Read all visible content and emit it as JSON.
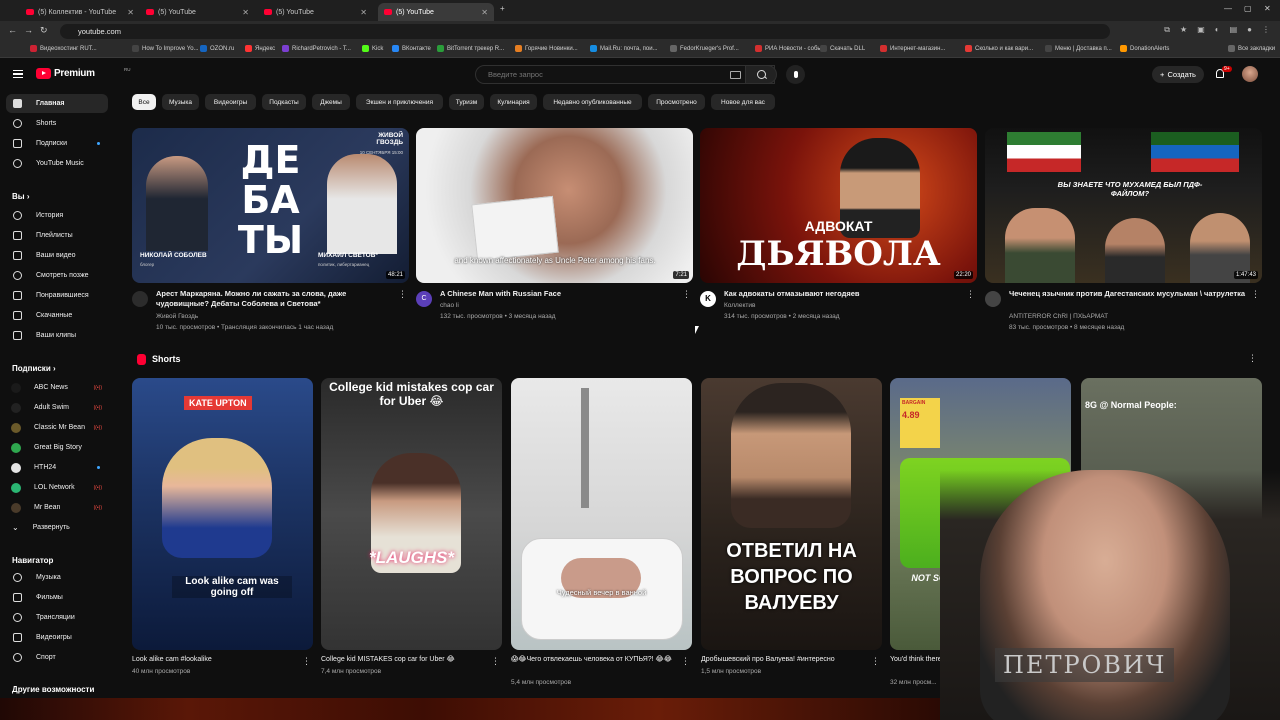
{
  "browser": {
    "tabs": [
      {
        "label": "(5) Коллектив - YouTube"
      },
      {
        "label": "(5) YouTube"
      },
      {
        "label": "(5) YouTube"
      },
      {
        "label": "(5) YouTube"
      }
    ],
    "url": "youtube.com",
    "bookmarks": [
      "Видеохостинг RUT...",
      "How To Improve Yo...",
      "OZON.ru",
      "Яндекс",
      "RichardPetrovich - T...",
      "Kick",
      "ВКонтакте",
      "BitTorrent трекер R...",
      "Горячие Новинки...",
      "Mail.Ru: почта, пои...",
      "FedorKrueger's Prof...",
      "РИА Новости - собы...",
      "Скачать DLL",
      "Интернет-магазин...",
      "Сколько и как вари...",
      "Меню | Доставка п...",
      "DonationAlerts",
      "Все закладки"
    ]
  },
  "header": {
    "logo": "Premium",
    "logo_region": "RU",
    "search_placeholder": "Введите запрос",
    "create_label": "Создать",
    "notif_count": "9+"
  },
  "sidebar": {
    "main": [
      {
        "label": "Главная"
      },
      {
        "label": "Shorts"
      },
      {
        "label": "Подписки"
      },
      {
        "label": "YouTube Music"
      }
    ],
    "you_header": "Вы",
    "you": [
      {
        "label": "История"
      },
      {
        "label": "Плейлисты"
      },
      {
        "label": "Ваши видео"
      },
      {
        "label": "Смотреть позже"
      },
      {
        "label": "Понравившиеся"
      },
      {
        "label": "Скачанные"
      },
      {
        "label": "Ваши клипы"
      }
    ],
    "subs_header": "Подписки",
    "subs": [
      {
        "label": "ABC News",
        "color": "#1a1a1a"
      },
      {
        "label": "Adult Swim",
        "color": "#222222"
      },
      {
        "label": "Classic Mr Bean",
        "color": "#6b5a2a"
      },
      {
        "label": "Great Big Story",
        "color": "#2fa84f"
      },
      {
        "label": "HTH24",
        "color": "#e5e5e5"
      },
      {
        "label": "LOL Network",
        "color": "#2bb673"
      },
      {
        "label": "Mr Bean",
        "color": "#4a3b2a"
      },
      {
        "label": "Развернуть",
        "color": ""
      }
    ],
    "nav_header": "Навигатор",
    "nav": [
      {
        "label": "Музыка"
      },
      {
        "label": "Фильмы"
      },
      {
        "label": "Трансляции"
      },
      {
        "label": "Видеоигры"
      },
      {
        "label": "Спорт"
      }
    ],
    "more_header": "Другие возможности"
  },
  "chips": [
    "Все",
    "Музыка",
    "Видеоигры",
    "Подкасты",
    "Джемы",
    "Экшен и приключения",
    "Туризм",
    "Кулинария",
    "Недавно опубликованные",
    "Просмотрено",
    "Новое для вас"
  ],
  "videos": [
    {
      "title": "Арест Маркаряна. Можно ли сажать за слова, даже чудовищные? Дебаты Соболева и Светова*",
      "channel": "Живой Гвоздь",
      "stats": "10 тыс. просмотров • Трансляция закончилась 1 час назад",
      "duration": "48:21",
      "thumb_text": [
        "ДЕ",
        "БА",
        "ТЫ"
      ],
      "thumb_tag": "ЖИВОЙ ГВОЗДЬ",
      "thumb_date": "10 СЕНТЯБРЯ 15:00",
      "name_left": "НИКОЛАЙ СОБОЛЕВ",
      "name_left_sub": "блогер",
      "name_right": "МИХАИЛ СВЕТОВ*",
      "name_right_sub": "политик, либертарианец"
    },
    {
      "title": "A Chinese Man with Russian Face",
      "channel": "chao li",
      "stats": "132 тыс. просмотров • 3 месяца назад",
      "duration": "7:21",
      "caption": "and known affectionately as Uncle Peter among his fans.",
      "avatar_letter": "C"
    },
    {
      "title": "Как адвокаты отмазывают негодяев",
      "channel": "Коллектив",
      "stats": "314 тыс. просмотров • 2 месяца назад",
      "duration": "22:20",
      "thumb_line1": "АДВОКАТ",
      "thumb_line2": "ДЬЯВОЛА",
      "avatar_letter": "K"
    },
    {
      "title": "Чеченец язычник против Дагестанских мусульман \\ чатрулетка",
      "channel": "ANTITERROR ChRI | ПХЬАРМАТ",
      "stats": "83 тыс. просмотров • 8 месяцев назад",
      "duration": "1:47:43",
      "thumb_text": "ВЫ ЗНАЕТЕ ЧТО МУХАМЕД БЫЛ ПДФ-ФАЙЛОМ?"
    }
  ],
  "shorts_header": "Shorts",
  "shorts": [
    {
      "title": "Look alike cam #lookalike",
      "views": "40 млн просмотров",
      "top": "KATE UPTON",
      "bottom": "Look alike cam was going off"
    },
    {
      "title": "College kid MISTAKES cop car for Uber 😂",
      "views": "7,4 млн просмотров",
      "top": "College kid mistakes cop car for Uber 😂",
      "bottom": "*LAUGHS*"
    },
    {
      "title": "😱😂Чего отвлекаешь человека от КУПЬЯ?! 😂😂",
      "views": "5,4 млн просмотров",
      "bottom": "Чудесный вечер в ванной"
    },
    {
      "title": "Дробышевский про Валуева! #интересно",
      "views": "1,5 млн просмотров",
      "bottom": "ОТВЕТИЛ НА ВОПРОС ПО ВАЛУЕВУ"
    },
    {
      "title": "You'd think there w... #western #shor...",
      "views": "32 млн просм...",
      "bottom": "NOT SO F**KI... TOUGH N...",
      "sign_top": "BARGAIN",
      "sign_price": "4.89"
    },
    {
      "title": "",
      "views": "",
      "top": "8G @ Normal People:"
    }
  ],
  "webcam": {
    "label": "ПЕТРОВИЧ"
  }
}
